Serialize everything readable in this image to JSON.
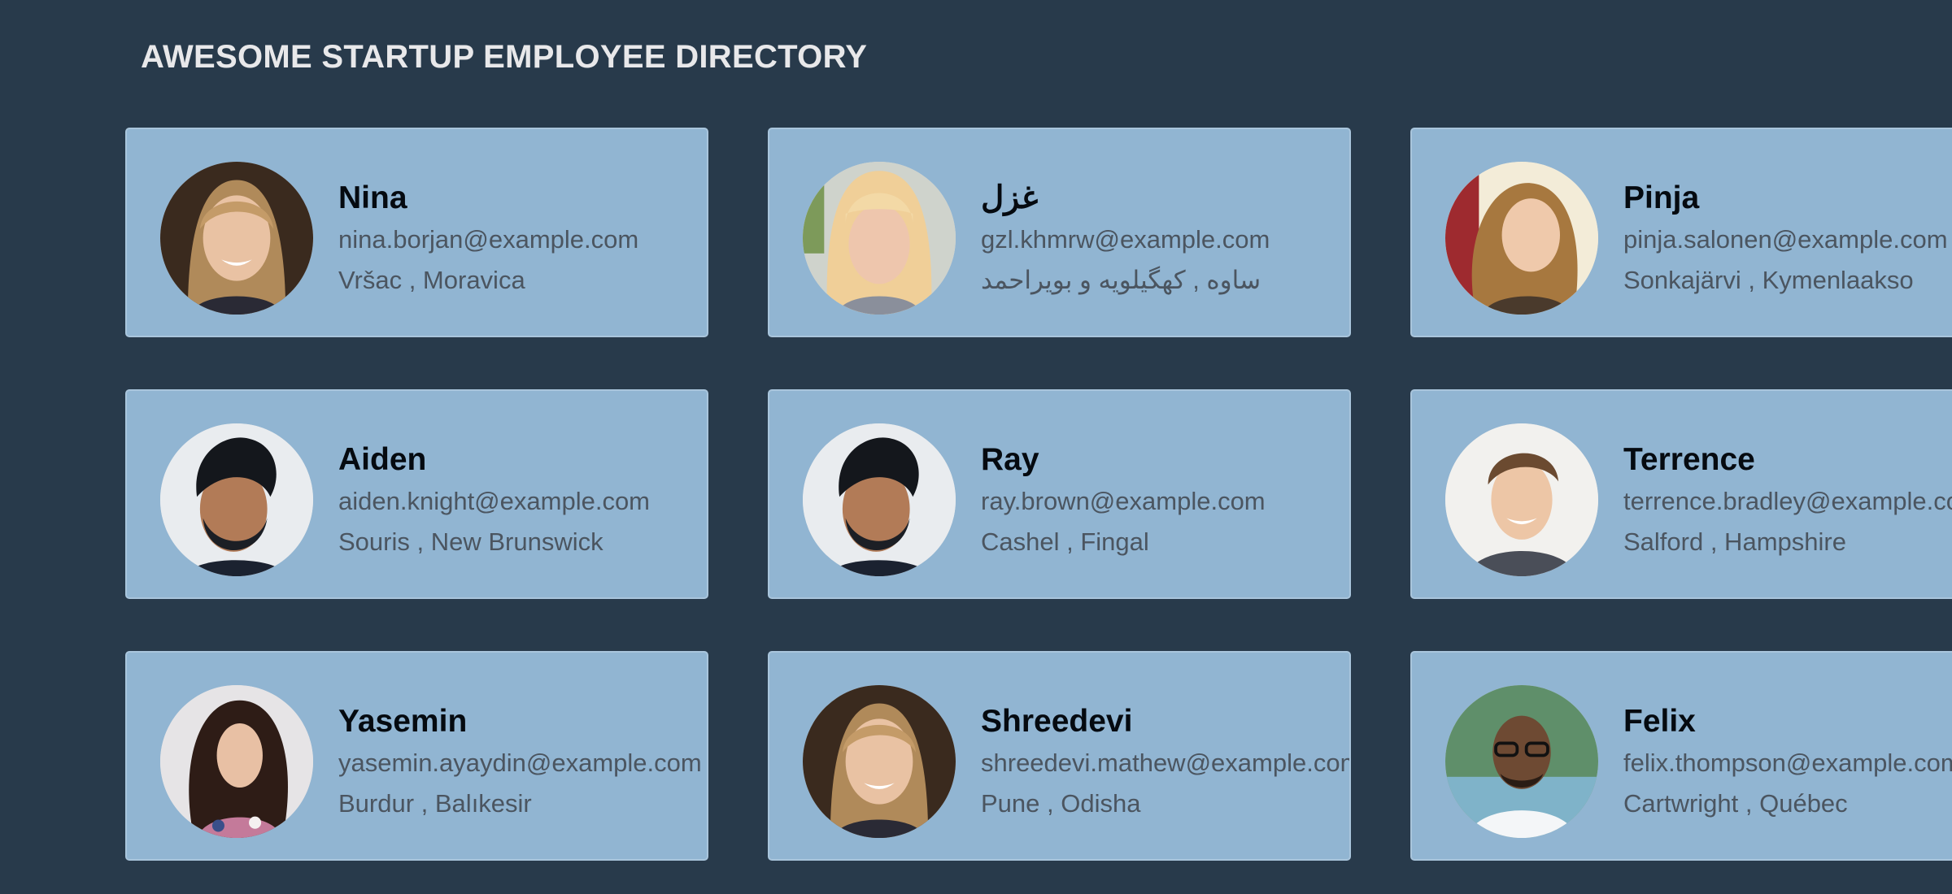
{
  "header": {
    "title": "AWESOME STARTUP EMPLOYEE DIRECTORY"
  },
  "colors": {
    "background": "#283a4b",
    "card": "#91b5d2",
    "name": "#050a10",
    "detail": "#4b5560",
    "title": "#e8e8ea"
  },
  "employees": [
    {
      "name": "Nina",
      "email": "nina.borjan@example.com",
      "location": "Vršac , Moravica",
      "photo": "avatar-photo"
    },
    {
      "name": "غزل",
      "email": "gzl.khmrw@example.com",
      "location": "ساوه , کهگیلویه و بویراحمد",
      "photo": "avatar-photo"
    },
    {
      "name": "Pinja",
      "email": "pinja.salonen@example.com",
      "location": "Sonkajärvi , Kymenlaakso",
      "photo": "avatar-photo"
    },
    {
      "name": "Aiden",
      "email": "aiden.knight@example.com",
      "location": "Souris , New Brunswick",
      "photo": "avatar-photo"
    },
    {
      "name": "Ray",
      "email": "ray.brown@example.com",
      "location": "Cashel , Fingal",
      "photo": "avatar-photo"
    },
    {
      "name": "Terrence",
      "email": "terrence.bradley@example.com",
      "location": "Salford , Hampshire",
      "photo": "avatar-photo"
    },
    {
      "name": "Yasemin",
      "email": "yasemin.ayaydin@example.com",
      "location": "Burdur , Balıkesir",
      "photo": "avatar-photo"
    },
    {
      "name": "Shreedevi",
      "email": "shreedevi.mathew@example.com",
      "location": "Pune , Odisha",
      "photo": "avatar-photo"
    },
    {
      "name": "Felix",
      "email": "felix.thompson@example.com",
      "location": "Cartwright , Québec",
      "photo": "avatar-photo"
    }
  ]
}
